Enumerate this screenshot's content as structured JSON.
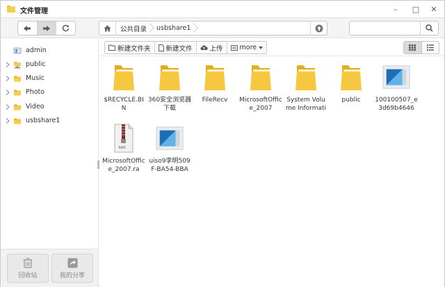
{
  "window": {
    "title": "文件管理",
    "minimize": "–",
    "maximize": "□",
    "close": "✕"
  },
  "nav": {
    "path": [
      "公共目录",
      "usbshare1"
    ],
    "search_placeholder": ""
  },
  "sidebar": {
    "items": [
      {
        "label": "admin",
        "icon": "user-icon",
        "expandable": false
      },
      {
        "label": "public",
        "icon": "network-folder-icon",
        "expandable": true
      },
      {
        "label": "Music",
        "icon": "folder-icon",
        "expandable": true
      },
      {
        "label": "Photo",
        "icon": "folder-icon",
        "expandable": true
      },
      {
        "label": "Video",
        "icon": "folder-icon",
        "expandable": true
      },
      {
        "label": "usbshare1",
        "icon": "folder-icon",
        "expandable": true
      }
    ],
    "recycle_label": "回收站",
    "share_label": "我的分享"
  },
  "toolbar": {
    "new_folder": "新建文件夹",
    "new_file": "新建文件",
    "upload": "上传",
    "more": "more"
  },
  "files": [
    {
      "name": "$RECYCLE.BIN",
      "type": "folder"
    },
    {
      "name": "360安全浏览器下载",
      "type": "folder"
    },
    {
      "name": "FileRecv",
      "type": "folder"
    },
    {
      "name": "MicrosoftOffice_2007",
      "type": "folder"
    },
    {
      "name": "System Volume Informati",
      "type": "folder"
    },
    {
      "name": "public",
      "type": "folder"
    },
    {
      "name": "100100507_e3d69b4646",
      "type": "image"
    },
    {
      "name": "MicrosoftOffice_2007.ra",
      "type": "rar",
      "badge": "RAR"
    },
    {
      "name": "uiso9李明509F-BA54-BBA",
      "type": "image"
    }
  ],
  "colors": {
    "folder": "#f4c542",
    "folder_dark": "#e5ac1e",
    "accent": "#3a86c8"
  }
}
